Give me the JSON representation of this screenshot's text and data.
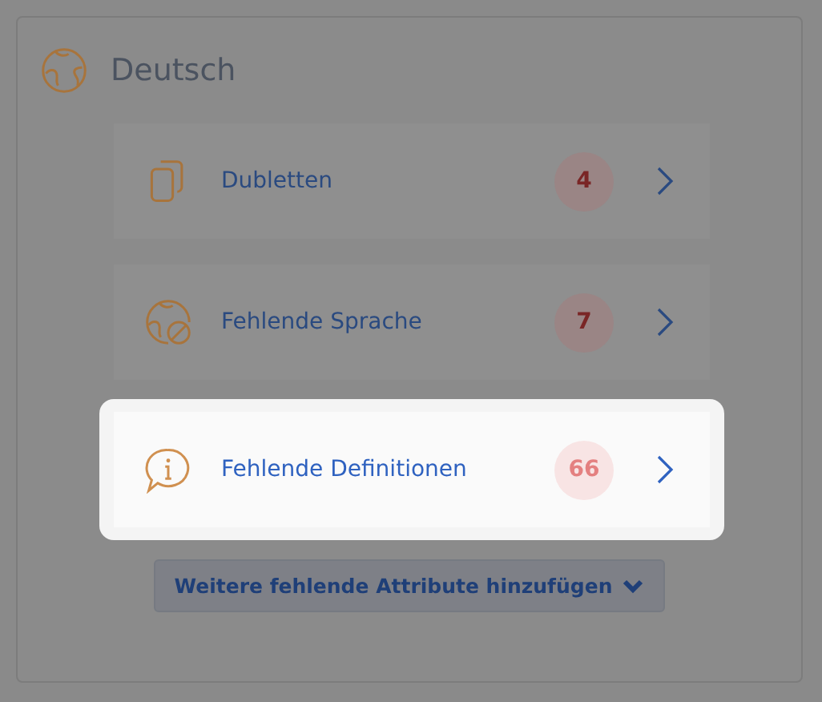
{
  "section": {
    "title": "Deutsch"
  },
  "items": [
    {
      "kind": "copy",
      "label": "Dubletten",
      "count": "4",
      "highlighted": false
    },
    {
      "kind": "globe-blocked",
      "label": "Fehlende Sprache",
      "count": "7",
      "highlighted": false
    },
    {
      "kind": "info-bubble",
      "label": "Fehlende Definitionen",
      "count": "66",
      "highlighted": true
    }
  ],
  "more_button": {
    "label": "Weitere fehlende Attribute hinzufügen"
  }
}
